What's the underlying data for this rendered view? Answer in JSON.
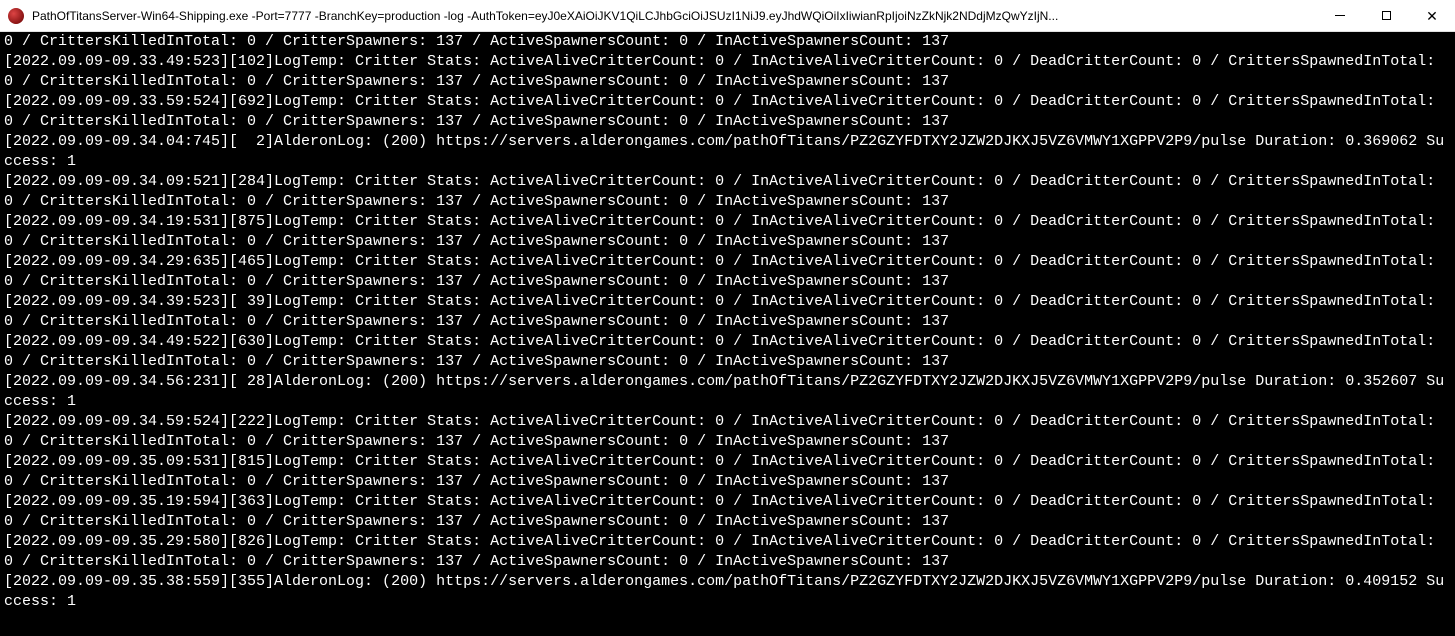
{
  "window": {
    "title": "PathOfTitansServer-Win64-Shipping.exe  -Port=7777 -BranchKey=production -log -AuthToken=eyJ0eXAiOiJKV1QiLCJhbGciOiJSUzI1NiJ9.eyJhdWQiOiIxIiwianRpIjoiNzZkNjk2NDdjMzQwYzIjN..."
  },
  "log_lines": [
    "0 / CrittersKilledInTotal: 0 / CritterSpawners: 137 / ActiveSpawnersCount: 0 / InActiveSpawnersCount: 137",
    "[2022.09.09-09.33.49:523][102]LogTemp: Critter Stats: ActiveAliveCritterCount: 0 / InActiveAliveCritterCount: 0 / DeadCritterCount: 0 / CrittersSpawnedInTotal: 0 / CrittersKilledInTotal: 0 / CritterSpawners: 137 / ActiveSpawnersCount: 0 / InActiveSpawnersCount: 137",
    "[2022.09.09-09.33.59:524][692]LogTemp: Critter Stats: ActiveAliveCritterCount: 0 / InActiveAliveCritterCount: 0 / DeadCritterCount: 0 / CrittersSpawnedInTotal: 0 / CrittersKilledInTotal: 0 / CritterSpawners: 137 / ActiveSpawnersCount: 0 / InActiveSpawnersCount: 137",
    "[2022.09.09-09.34.04:745][  2]AlderonLog: (200) https://servers.alderongames.com/pathOfTitans/PZ2GZYFDTXY2JZW2DJKXJ5VZ6VMWY1XGPPV2P9/pulse Duration: 0.369062 Success: 1",
    "[2022.09.09-09.34.09:521][284]LogTemp: Critter Stats: ActiveAliveCritterCount: 0 / InActiveAliveCritterCount: 0 / DeadCritterCount: 0 / CrittersSpawnedInTotal: 0 / CrittersKilledInTotal: 0 / CritterSpawners: 137 / ActiveSpawnersCount: 0 / InActiveSpawnersCount: 137",
    "[2022.09.09-09.34.19:531][875]LogTemp: Critter Stats: ActiveAliveCritterCount: 0 / InActiveAliveCritterCount: 0 / DeadCritterCount: 0 / CrittersSpawnedInTotal: 0 / CrittersKilledInTotal: 0 / CritterSpawners: 137 / ActiveSpawnersCount: 0 / InActiveSpawnersCount: 137",
    "[2022.09.09-09.34.29:635][465]LogTemp: Critter Stats: ActiveAliveCritterCount: 0 / InActiveAliveCritterCount: 0 / DeadCritterCount: 0 / CrittersSpawnedInTotal: 0 / CrittersKilledInTotal: 0 / CritterSpawners: 137 / ActiveSpawnersCount: 0 / InActiveSpawnersCount: 137",
    "[2022.09.09-09.34.39:523][ 39]LogTemp: Critter Stats: ActiveAliveCritterCount: 0 / InActiveAliveCritterCount: 0 / DeadCritterCount: 0 / CrittersSpawnedInTotal: 0 / CrittersKilledInTotal: 0 / CritterSpawners: 137 / ActiveSpawnersCount: 0 / InActiveSpawnersCount: 137",
    "[2022.09.09-09.34.49:522][630]LogTemp: Critter Stats: ActiveAliveCritterCount: 0 / InActiveAliveCritterCount: 0 / DeadCritterCount: 0 / CrittersSpawnedInTotal: 0 / CrittersKilledInTotal: 0 / CritterSpawners: 137 / ActiveSpawnersCount: 0 / InActiveSpawnersCount: 137",
    "[2022.09.09-09.34.56:231][ 28]AlderonLog: (200) https://servers.alderongames.com/pathOfTitans/PZ2GZYFDTXY2JZW2DJKXJ5VZ6VMWY1XGPPV2P9/pulse Duration: 0.352607 Success: 1",
    "[2022.09.09-09.34.59:524][222]LogTemp: Critter Stats: ActiveAliveCritterCount: 0 / InActiveAliveCritterCount: 0 / DeadCritterCount: 0 / CrittersSpawnedInTotal: 0 / CrittersKilledInTotal: 0 / CritterSpawners: 137 / ActiveSpawnersCount: 0 / InActiveSpawnersCount: 137",
    "[2022.09.09-09.35.09:531][815]LogTemp: Critter Stats: ActiveAliveCritterCount: 0 / InActiveAliveCritterCount: 0 / DeadCritterCount: 0 / CrittersSpawnedInTotal: 0 / CrittersKilledInTotal: 0 / CritterSpawners: 137 / ActiveSpawnersCount: 0 / InActiveSpawnersCount: 137",
    "[2022.09.09-09.35.19:594][363]LogTemp: Critter Stats: ActiveAliveCritterCount: 0 / InActiveAliveCritterCount: 0 / DeadCritterCount: 0 / CrittersSpawnedInTotal: 0 / CrittersKilledInTotal: 0 / CritterSpawners: 137 / ActiveSpawnersCount: 0 / InActiveSpawnersCount: 137",
    "[2022.09.09-09.35.29:580][826]LogTemp: Critter Stats: ActiveAliveCritterCount: 0 / InActiveAliveCritterCount: 0 / DeadCritterCount: 0 / CrittersSpawnedInTotal: 0 / CrittersKilledInTotal: 0 / CritterSpawners: 137 / ActiveSpawnersCount: 0 / InActiveSpawnersCount: 137",
    "[2022.09.09-09.35.38:559][355]AlderonLog: (200) https://servers.alderongames.com/pathOfTitans/PZ2GZYFDTXY2JZW2DJKXJ5VZ6VMWY1XGPPV2P9/pulse Duration: 0.409152 Success: 1"
  ]
}
